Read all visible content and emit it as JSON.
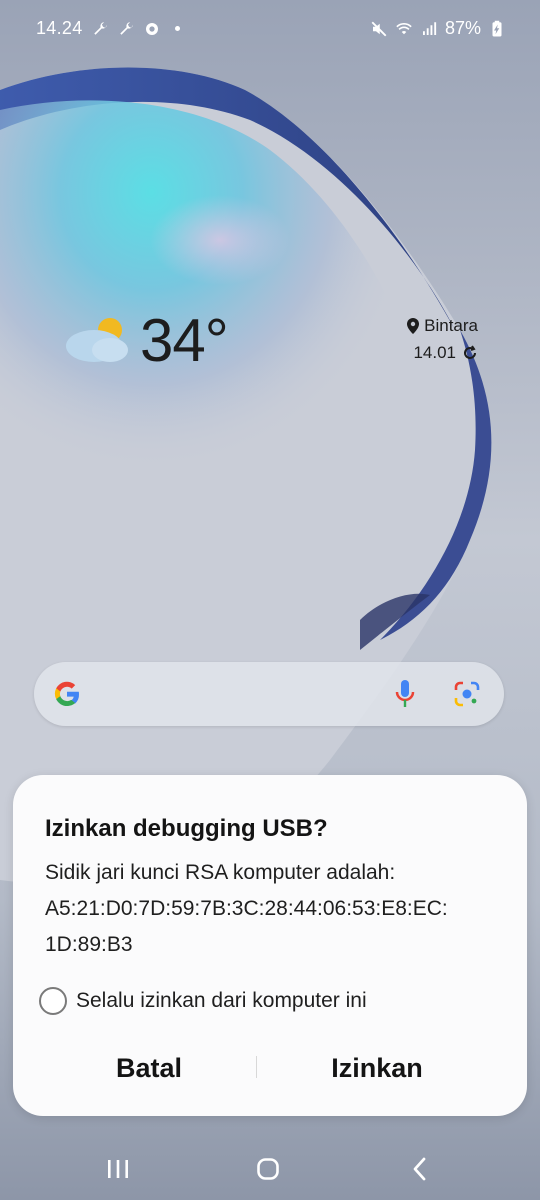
{
  "status_bar": {
    "time": "14.24",
    "battery": "87%",
    "left_icons": [
      "wrench-icon",
      "wrench-icon",
      "sync-icon",
      "dot-icon"
    ],
    "right_icons": [
      "mute-icon",
      "wifi-icon",
      "signal-icon",
      "battery-charging-icon"
    ]
  },
  "weather": {
    "temperature": "34°",
    "location": "Bintara",
    "updated": "14.01",
    "condition_icon": "partly-cloudy-icon"
  },
  "search": {
    "icons": [
      "google-g-icon",
      "microphone-icon",
      "google-lens-icon"
    ]
  },
  "dialog": {
    "title": "Izinkan debugging USB?",
    "body_line1": "Sidik jari kunci RSA komputer adalah:",
    "body_line2": "A5:21:D0:7D:59:7B:3C:28:44:06:53:E8:EC:",
    "body_line3": "1D:89:B3",
    "checkbox_label": "Selalu izinkan dari komputer ini",
    "checkbox_checked": false,
    "cancel_label": "Batal",
    "allow_label": "Izinkan"
  },
  "nav_bar": {
    "icons": [
      "recent-apps-icon",
      "home-icon",
      "back-icon"
    ]
  },
  "colors": {
    "dialog_bg": "#fbfbfc",
    "wallpaper_base": "#aab2c0",
    "accent_blue": "#2a5bd0"
  }
}
